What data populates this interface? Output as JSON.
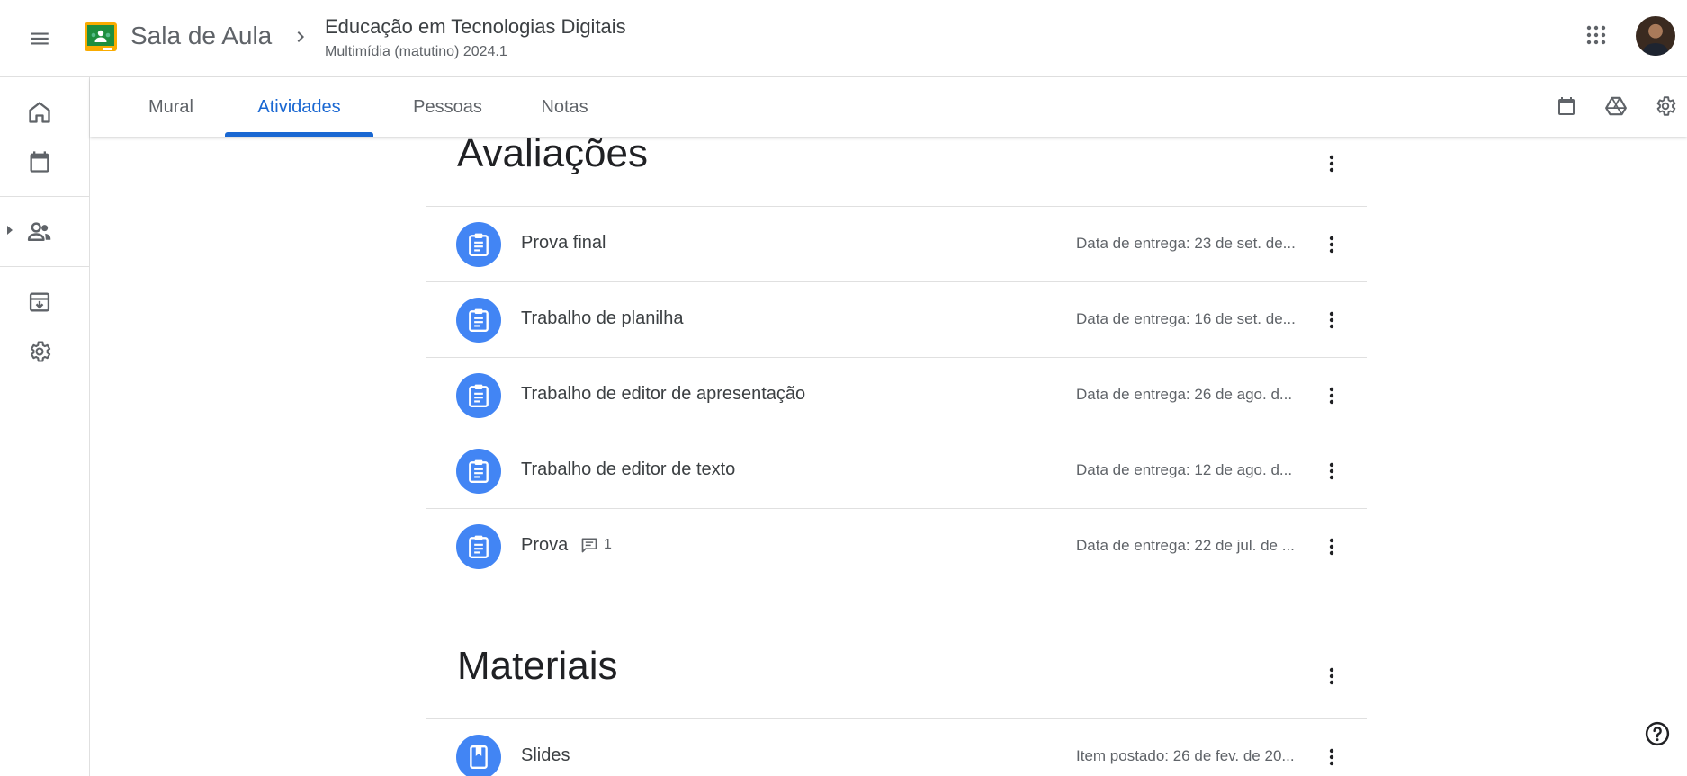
{
  "header": {
    "app_name": "Sala de Aula",
    "course_title": "Educação em Tecnologias Digitais",
    "course_section": "Multimídia (matutino) 2024.1"
  },
  "tabs": [
    {
      "label": "Mural",
      "active": false
    },
    {
      "label": "Atividades",
      "active": true
    },
    {
      "label": "Pessoas",
      "active": false
    },
    {
      "label": "Notas",
      "active": false
    }
  ],
  "topics": [
    {
      "title": "Avaliações",
      "items": [
        {
          "title": "Prova final",
          "due": "Data de entrega: 23 de set. de...",
          "icon": "assignment-icon"
        },
        {
          "title": "Trabalho de planilha",
          "due": "Data de entrega: 16 de set. de...",
          "icon": "assignment-icon"
        },
        {
          "title": "Trabalho de editor de apresentação",
          "due": "Data de entrega: 26 de ago. d...",
          "icon": "assignment-icon"
        },
        {
          "title": "Trabalho de editor de texto",
          "due": "Data de entrega: 12 de ago. d...",
          "icon": "assignment-icon"
        },
        {
          "title": "Prova",
          "comments": "1",
          "due": "Data de entrega: 22 de jul. de ...",
          "icon": "assignment-icon"
        }
      ]
    },
    {
      "title": "Materiais",
      "items": [
        {
          "title": "Slides",
          "due": "Item postado: 26 de fev. de 20...",
          "icon": "material-icon"
        }
      ]
    }
  ],
  "colors": {
    "accent": "#1967d2",
    "item_icon_bg": "#4285f4",
    "logo_green": "#1e8e3e",
    "logo_yellow": "#f9ab00"
  }
}
